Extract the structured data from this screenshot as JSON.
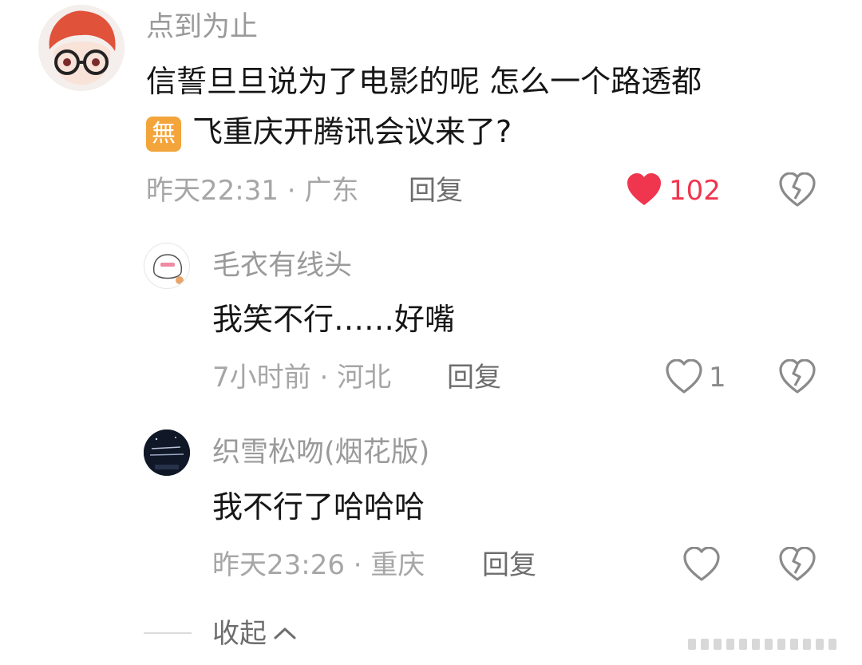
{
  "comment": {
    "username": "点到为止",
    "text_line1": "信誓旦旦说为了电影的呢 怎么一个路透都",
    "badge_char": "無",
    "text_line2": "飞重庆开腾讯会议来了?",
    "time": "昨天22:31",
    "location": "广东",
    "reply_label": "回复",
    "like_count": "102",
    "liked": true,
    "like_color": "#f0354f"
  },
  "replies": [
    {
      "username": "毛衣有线头",
      "text": "我笑不行……好嘴",
      "time": "7小时前",
      "location": "河北",
      "reply_label": "回复",
      "like_count": "1"
    },
    {
      "username": "织雪松吻(烟花版)",
      "text": "我不行了哈哈哈",
      "time": "昨天23:26",
      "location": "重庆",
      "reply_label": "回复",
      "like_count": ""
    }
  ],
  "collapse_label": "收起",
  "icons": [
    "heart-icon",
    "broken-heart-icon",
    "chevron-up-icon"
  ]
}
